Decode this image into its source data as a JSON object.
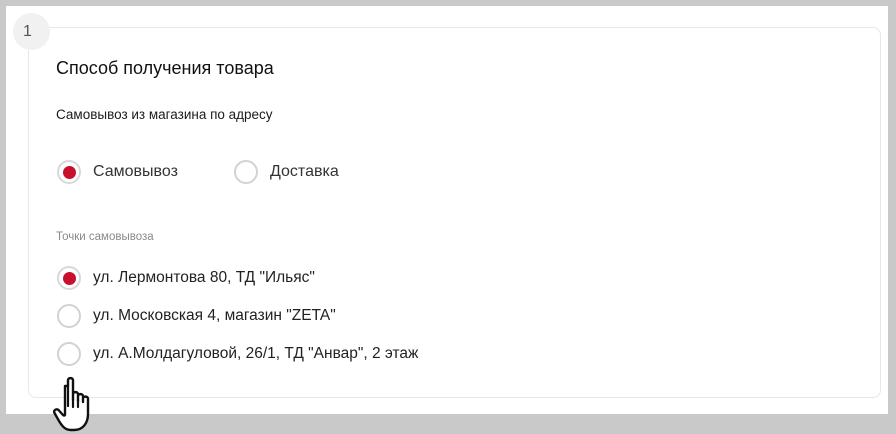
{
  "step": {
    "number": "1"
  },
  "section": {
    "title": "Способ получения товара",
    "subtitle": "Самовывоз из магазина по адресу"
  },
  "delivery_method": {
    "options": [
      {
        "label": "Самовывоз",
        "selected": true
      },
      {
        "label": "Доставка",
        "selected": false
      }
    ]
  },
  "pickup_points": {
    "label": "Точки самовывоза",
    "items": [
      {
        "label": "ул. Лермонтова 80, ТД \"Ильяс\"",
        "selected": true
      },
      {
        "label": "ул. Московская 4, магазин \"ZETA\"",
        "selected": false
      },
      {
        "label": "ул. А.Молдагуловой, 26/1, ТД \"Анвар\", 2 этаж",
        "selected": false
      }
    ]
  },
  "colors": {
    "accent": "#c8102e",
    "frame": "#c9c9c9"
  },
  "cursor": {
    "icon": "hand-pointer-icon"
  }
}
